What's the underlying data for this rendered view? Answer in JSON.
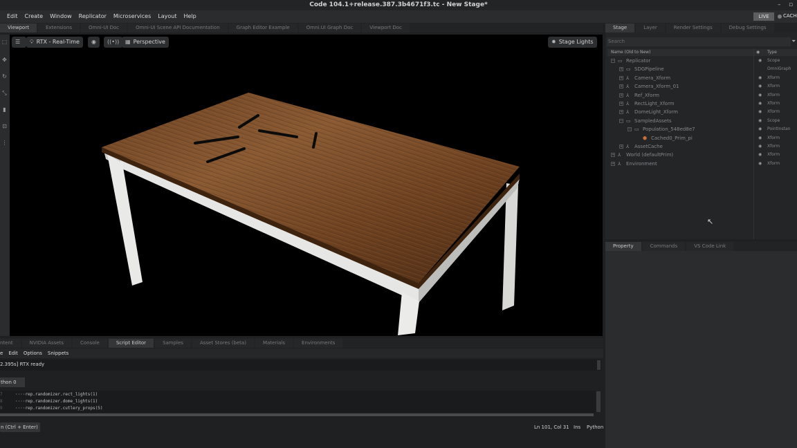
{
  "window": {
    "title": "Code 104.1+release.387.3b4671f3.tc - New Stage*",
    "minimize": "–",
    "maximize": "▫"
  },
  "menu": [
    "Edit",
    "Create",
    "Window",
    "Replicator",
    "Microservices",
    "Layout",
    "Help"
  ],
  "live": {
    "badge": "LIVE",
    "cache": "CACH"
  },
  "viewport_tabs": [
    {
      "label": "Viewport",
      "active": true
    },
    {
      "label": "Extensions",
      "active": false
    },
    {
      "label": "Omni-UI Doc",
      "active": false
    },
    {
      "label": "Omni-UI Scene API Documentation",
      "active": false
    },
    {
      "label": "Graph Editor Example",
      "active": false
    },
    {
      "label": "Omni.UI Graph Doc",
      "active": false
    },
    {
      "label": "Viewport Doc",
      "active": false
    }
  ],
  "viewport": {
    "render_mode": "RTX - Real-Time",
    "camera": "Perspective",
    "stage_lights": "Stage Lights"
  },
  "stage_tabs": [
    {
      "label": "Stage",
      "active": true
    },
    {
      "label": "Layer",
      "active": false
    },
    {
      "label": "Render Settings",
      "active": false
    },
    {
      "label": "Debug Settings",
      "active": false
    }
  ],
  "stage": {
    "search_placeholder": "Search",
    "col_name": "Name (Old to New)",
    "col_type": "Type",
    "rows": [
      {
        "name": "Replicator",
        "type": "Scope",
        "depth": 0,
        "icon": "folder",
        "eye": true
      },
      {
        "name": "SDGPipeline",
        "type": "OmniGraph",
        "depth": 1,
        "icon": "folder",
        "eye": false
      },
      {
        "name": "Camera_Xform",
        "type": "Xform",
        "depth": 1,
        "icon": "xform",
        "eye": true
      },
      {
        "name": "Camera_Xform_01",
        "type": "Xform",
        "depth": 1,
        "icon": "xform",
        "eye": true
      },
      {
        "name": "Ref_Xform",
        "type": "Xform",
        "depth": 1,
        "icon": "xform",
        "eye": true
      },
      {
        "name": "RectLight_Xform",
        "type": "Xform",
        "depth": 1,
        "icon": "xform",
        "eye": true
      },
      {
        "name": "DomeLight_Xform",
        "type": "Xform",
        "depth": 1,
        "icon": "xform",
        "eye": true
      },
      {
        "name": "SampledAssets",
        "type": "Scope",
        "depth": 1,
        "icon": "folder",
        "eye": true
      },
      {
        "name": "Population_548ed8e7",
        "type": "PointInstan",
        "depth": 2,
        "icon": "folder",
        "eye": true
      },
      {
        "name": "Cached0_Prim_pi",
        "type": "Xform",
        "depth": 3,
        "icon": "prim",
        "eye": true
      },
      {
        "name": "AssetCache",
        "type": "Xform",
        "depth": 1,
        "icon": "xform",
        "eye": true
      },
      {
        "name": "World (defaultPrim)",
        "type": "Xform",
        "depth": 0,
        "icon": "xform",
        "eye": true
      },
      {
        "name": "Environment",
        "type": "Xform",
        "depth": 0,
        "icon": "xform",
        "eye": true
      }
    ]
  },
  "property_tabs": [
    {
      "label": "Property",
      "active": true
    },
    {
      "label": "Commands",
      "active": false
    },
    {
      "label": "VS Code Link",
      "active": false
    }
  ],
  "bottom_tabs": [
    {
      "label": "ntent",
      "active": false
    },
    {
      "label": "NVIDIA Assets",
      "active": false
    },
    {
      "label": "Console",
      "active": false
    },
    {
      "label": "Script Editor",
      "active": true
    },
    {
      "label": "Samples",
      "active": false
    },
    {
      "label": "Asset Stores (beta)",
      "active": false
    },
    {
      "label": "Materials",
      "active": false
    },
    {
      "label": "Environments",
      "active": false
    }
  ],
  "script_menu": [
    "e",
    "Edit",
    "Options",
    "Snippets"
  ],
  "console_line": "2.395s] RTX ready",
  "script_tab": "thon 0",
  "code_lines": [
    {
      "ln": "7",
      "text": "····rep.randomizer.rect_lights(1)"
    },
    {
      "ln": "8",
      "text": "····rep.randomizer.dome_lights(1)"
    },
    {
      "ln": "9",
      "text": "····rep.randomizer.cutlery_props(5)"
    }
  ],
  "run_button": "n (Ctrl + Enter)",
  "status": {
    "cursor": "Ln 101, Col 31",
    "mode": "Ins",
    "lang": "Python"
  },
  "colors": {
    "wood_light": "#8a5a33",
    "wood_dark": "#4a2b15",
    "table_legs": "#e8e8e6",
    "panel_bg": "#242526",
    "accent_text": "#c8cacc"
  }
}
